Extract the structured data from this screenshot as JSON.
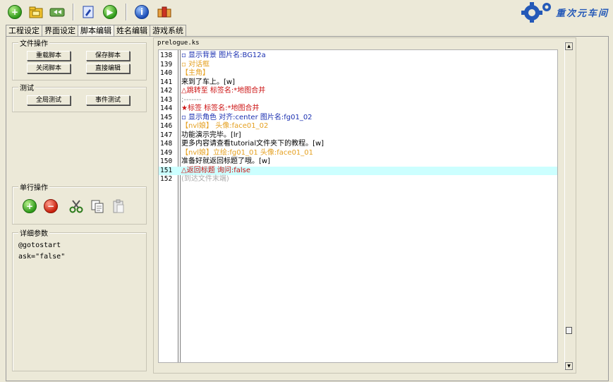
{
  "logo": {
    "text": "重次元车间"
  },
  "tabs": [
    {
      "label": "工程设定"
    },
    {
      "label": "界面设定"
    },
    {
      "label": "脚本编辑"
    },
    {
      "label": "姓名编辑"
    },
    {
      "label": "游戏系统"
    }
  ],
  "file_ops": {
    "title": "文件操作",
    "reload": "重载脚本",
    "save": "保存脚本",
    "close": "关闭脚本",
    "direct_edit": "直接编辑"
  },
  "test": {
    "title": "测试",
    "global": "全局测试",
    "event": "事件测试"
  },
  "single_line": {
    "title": "单行操作"
  },
  "params": {
    "title": "详细参数",
    "lines": [
      "@gotostart",
      "ask=\"false\""
    ]
  },
  "editor": {
    "filename": "prelogue.ks",
    "lines": [
      {
        "num": "138",
        "text": "▫ 显示背景 图片名:BG12a",
        "color": "#1a2fb0"
      },
      {
        "num": "139",
        "text": "▫ 对话框",
        "color": "#e5a020"
      },
      {
        "num": "140",
        "text": "【主角】",
        "color": "#e5a020"
      },
      {
        "num": "141",
        "text": "来到了车上。[w]",
        "color": "#000000"
      },
      {
        "num": "142",
        "text": "△跳转至 标签名:*地图合并",
        "color": "#cc1111"
      },
      {
        "num": "143",
        "text": ";-------",
        "color": "#888888"
      },
      {
        "num": "144",
        "text": "★标签 标签名:*地图合并",
        "color": "#cc1111"
      },
      {
        "num": "145",
        "text": "▫ 显示角色 对齐:center 图片名:fg01_02",
        "color": "#1a2fb0"
      },
      {
        "num": "146",
        "text": "【nvl娘】 头像:face01_02",
        "color": "#e5a020"
      },
      {
        "num": "147",
        "text": "功能演示完毕。[lr]",
        "color": "#000000"
      },
      {
        "num": "148",
        "text": "更多内容请查看tutorial文件夹下的教程。[w]",
        "color": "#000000"
      },
      {
        "num": "149",
        "text": "【nvl娘】立绘:fg01_01 头像:face01_01",
        "color": "#e5a020"
      },
      {
        "num": "150",
        "text": "准备好就返回标题了哦。[w]",
        "color": "#000000"
      },
      {
        "num": "151",
        "text": "△返回标题 询问:false",
        "color": "#cc1111",
        "highlight": true
      },
      {
        "num": "152",
        "text": "(到达文件末端)",
        "color": "#aaaaaa"
      }
    ]
  },
  "icons": {
    "toolbar": [
      "add-green-icon",
      "folder-icon",
      "rewind-icon",
      "script-icon",
      "play-green-icon",
      "info-blue-icon",
      "package-icon"
    ],
    "ops": [
      "plus-green-icon",
      "minus-red-icon",
      "cut-icon",
      "copy-icon",
      "paste-icon"
    ]
  }
}
